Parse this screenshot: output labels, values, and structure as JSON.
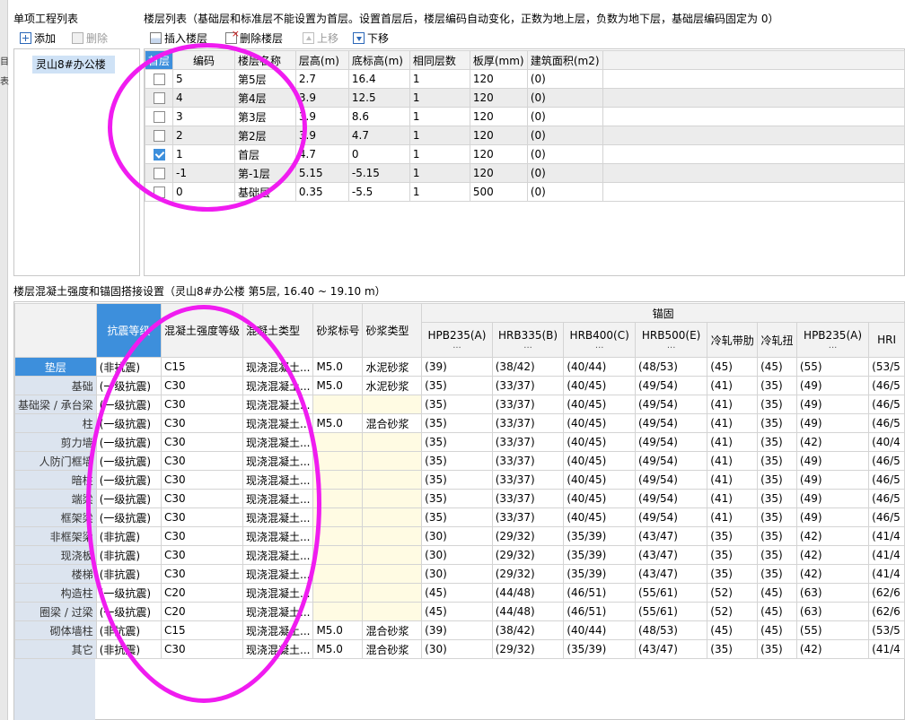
{
  "left_strip": [
    "目",
    "表"
  ],
  "project_panel": {
    "title": "单项工程列表",
    "add_label": "添加",
    "delete_label": "删除",
    "items": [
      "灵山8#办公楼"
    ]
  },
  "floor_panel": {
    "title": "楼层列表（基础层和标准层不能设置为首层。设置首层后，楼层编码自动变化，正数为地上层，负数为地下层，基础层编码固定为 0）",
    "toolbar": {
      "insert": "插入楼层",
      "remove": "删除楼层",
      "up": "上移",
      "down": "下移"
    },
    "headers": [
      "首层",
      "编码",
      "楼层名称",
      "层高(m)",
      "底标高(m)",
      "相同层数",
      "板厚(mm)",
      "建筑面积(m2)"
    ],
    "rows": [
      {
        "first": false,
        "code": "5",
        "name": "第5层",
        "height": "2.7",
        "bottom": "16.4",
        "same": "1",
        "slab": "120",
        "area": "(0)"
      },
      {
        "first": false,
        "code": "4",
        "name": "第4层",
        "height": "3.9",
        "bottom": "12.5",
        "same": "1",
        "slab": "120",
        "area": "(0)"
      },
      {
        "first": false,
        "code": "3",
        "name": "第3层",
        "height": "3.9",
        "bottom": "8.6",
        "same": "1",
        "slab": "120",
        "area": "(0)"
      },
      {
        "first": false,
        "code": "2",
        "name": "第2层",
        "height": "3.9",
        "bottom": "4.7",
        "same": "1",
        "slab": "120",
        "area": "(0)"
      },
      {
        "first": true,
        "code": "1",
        "name": "首层",
        "height": "4.7",
        "bottom": "0",
        "same": "1",
        "slab": "120",
        "area": "(0)"
      },
      {
        "first": false,
        "code": "-1",
        "name": "第-1层",
        "height": "5.15",
        "bottom": "-5.15",
        "same": "1",
        "slab": "120",
        "area": "(0)"
      },
      {
        "first": false,
        "code": "0",
        "name": "基础层",
        "height": "0.35",
        "bottom": "-5.5",
        "same": "1",
        "slab": "500",
        "area": "(0)"
      }
    ]
  },
  "concrete_panel": {
    "title": "楼层混凝土强度和锚固搭接设置（灵山8#办公楼  第5层, 16.40 ~ 19.10 m）",
    "group_header": "锚固",
    "headers": [
      "抗震等级",
      "混凝土强度等级",
      "混凝土类型",
      "砂浆标号",
      "砂浆类型"
    ],
    "anchor_headers": [
      {
        "label": "HPB235(A)",
        "sub": "..."
      },
      {
        "label": "HRB335(B)",
        "sub": "..."
      },
      {
        "label": "HRB400(C)",
        "sub": "..."
      },
      {
        "label": "HRB500(E)",
        "sub": "..."
      },
      {
        "label": "冷轧带肋",
        "sub": ""
      },
      {
        "label": "冷轧扭",
        "sub": ""
      },
      {
        "label": "HPB235(A)",
        "sub": "..."
      },
      {
        "label": "HRI",
        "sub": ""
      }
    ],
    "rows": [
      {
        "name": "垫层",
        "seismic": "(非抗震)",
        "strength": "C15",
        "type": "现浇混凝土...",
        "mortar": "M5.0",
        "mtype": "水泥砂浆",
        "a": [
          "(39)",
          "(38/42)",
          "(40/44)",
          "(48/53)",
          "(45)",
          "(45)",
          "(55)",
          "(53/5"
        ]
      },
      {
        "name": "基础",
        "seismic": "(一级抗震)",
        "strength": "C30",
        "type": "现浇混凝土...",
        "mortar": "M5.0",
        "mtype": "水泥砂浆",
        "a": [
          "(35)",
          "(33/37)",
          "(40/45)",
          "(49/54)",
          "(41)",
          "(35)",
          "(49)",
          "(46/5"
        ]
      },
      {
        "name": "基础梁 / 承台梁",
        "seismic": "(一级抗震)",
        "strength": "C30",
        "type": "现浇混凝土...",
        "mortar": "",
        "mtype": "",
        "a": [
          "(35)",
          "(33/37)",
          "(40/45)",
          "(49/54)",
          "(41)",
          "(35)",
          "(49)",
          "(46/5"
        ]
      },
      {
        "name": "柱",
        "seismic": "(一级抗震)",
        "strength": "C30",
        "type": "现浇混凝土...",
        "mortar": "M5.0",
        "mtype": "混合砂浆",
        "a": [
          "(35)",
          "(33/37)",
          "(40/45)",
          "(49/54)",
          "(41)",
          "(35)",
          "(49)",
          "(46/5"
        ]
      },
      {
        "name": "剪力墙",
        "seismic": "(一级抗震)",
        "strength": "C30",
        "type": "现浇混凝土...",
        "mortar": "",
        "mtype": "",
        "a": [
          "(35)",
          "(33/37)",
          "(40/45)",
          "(49/54)",
          "(41)",
          "(35)",
          "(42)",
          "(40/4"
        ]
      },
      {
        "name": "人防门框墙",
        "seismic": "(一级抗震)",
        "strength": "C30",
        "type": "现浇混凝土...",
        "mortar": "",
        "mtype": "",
        "a": [
          "(35)",
          "(33/37)",
          "(40/45)",
          "(49/54)",
          "(41)",
          "(35)",
          "(49)",
          "(46/5"
        ]
      },
      {
        "name": "暗柱",
        "seismic": "(一级抗震)",
        "strength": "C30",
        "type": "现浇混凝土...",
        "mortar": "",
        "mtype": "",
        "a": [
          "(35)",
          "(33/37)",
          "(40/45)",
          "(49/54)",
          "(41)",
          "(35)",
          "(49)",
          "(46/5"
        ]
      },
      {
        "name": "端梁",
        "seismic": "(一级抗震)",
        "strength": "C30",
        "type": "现浇混凝土...",
        "mortar": "",
        "mtype": "",
        "a": [
          "(35)",
          "(33/37)",
          "(40/45)",
          "(49/54)",
          "(41)",
          "(35)",
          "(49)",
          "(46/5"
        ]
      },
      {
        "name": "框架梁",
        "seismic": "(一级抗震)",
        "strength": "C30",
        "type": "现浇混凝土...",
        "mortar": "",
        "mtype": "",
        "a": [
          "(35)",
          "(33/37)",
          "(40/45)",
          "(49/54)",
          "(41)",
          "(35)",
          "(49)",
          "(46/5"
        ]
      },
      {
        "name": "非框架梁",
        "seismic": "(非抗震)",
        "strength": "C30",
        "type": "现浇混凝土...",
        "mortar": "",
        "mtype": "",
        "a": [
          "(30)",
          "(29/32)",
          "(35/39)",
          "(43/47)",
          "(35)",
          "(35)",
          "(42)",
          "(41/4"
        ]
      },
      {
        "name": "现浇板",
        "seismic": "(非抗震)",
        "strength": "C30",
        "type": "现浇混凝土...",
        "mortar": "",
        "mtype": "",
        "a": [
          "(30)",
          "(29/32)",
          "(35/39)",
          "(43/47)",
          "(35)",
          "(35)",
          "(42)",
          "(41/4"
        ]
      },
      {
        "name": "楼梯",
        "seismic": "(非抗震)",
        "strength": "C30",
        "type": "现浇混凝土...",
        "mortar": "",
        "mtype": "",
        "a": [
          "(30)",
          "(29/32)",
          "(35/39)",
          "(43/47)",
          "(35)",
          "(35)",
          "(42)",
          "(41/4"
        ]
      },
      {
        "name": "构造柱",
        "seismic": "(一级抗震)",
        "strength": "C20",
        "type": "现浇混凝土...",
        "mortar": "",
        "mtype": "",
        "a": [
          "(45)",
          "(44/48)",
          "(46/51)",
          "(55/61)",
          "(52)",
          "(45)",
          "(63)",
          "(62/6"
        ]
      },
      {
        "name": "圈梁 / 过梁",
        "seismic": "(一级抗震)",
        "strength": "C20",
        "type": "现浇混凝土...",
        "mortar": "",
        "mtype": "",
        "a": [
          "(45)",
          "(44/48)",
          "(46/51)",
          "(55/61)",
          "(52)",
          "(45)",
          "(63)",
          "(62/6"
        ]
      },
      {
        "name": "砌体墙柱",
        "seismic": "(非抗震)",
        "strength": "C15",
        "type": "现浇混凝土...",
        "mortar": "M5.0",
        "mtype": "混合砂浆",
        "a": [
          "(39)",
          "(38/42)",
          "(40/44)",
          "(48/53)",
          "(45)",
          "(45)",
          "(55)",
          "(53/5"
        ]
      },
      {
        "name": "其它",
        "seismic": "(非抗震)",
        "strength": "C30",
        "type": "现浇混凝土...",
        "mortar": "M5.0",
        "mtype": "混合砂浆",
        "a": [
          "(30)",
          "(29/32)",
          "(35/39)",
          "(43/47)",
          "(35)",
          "(35)",
          "(42)",
          "(41/4"
        ]
      }
    ]
  },
  "colors": {
    "selection": "#3d8fdc",
    "highlight_circle": "#f01cf0",
    "yellow_cell": "#fffbe3"
  }
}
